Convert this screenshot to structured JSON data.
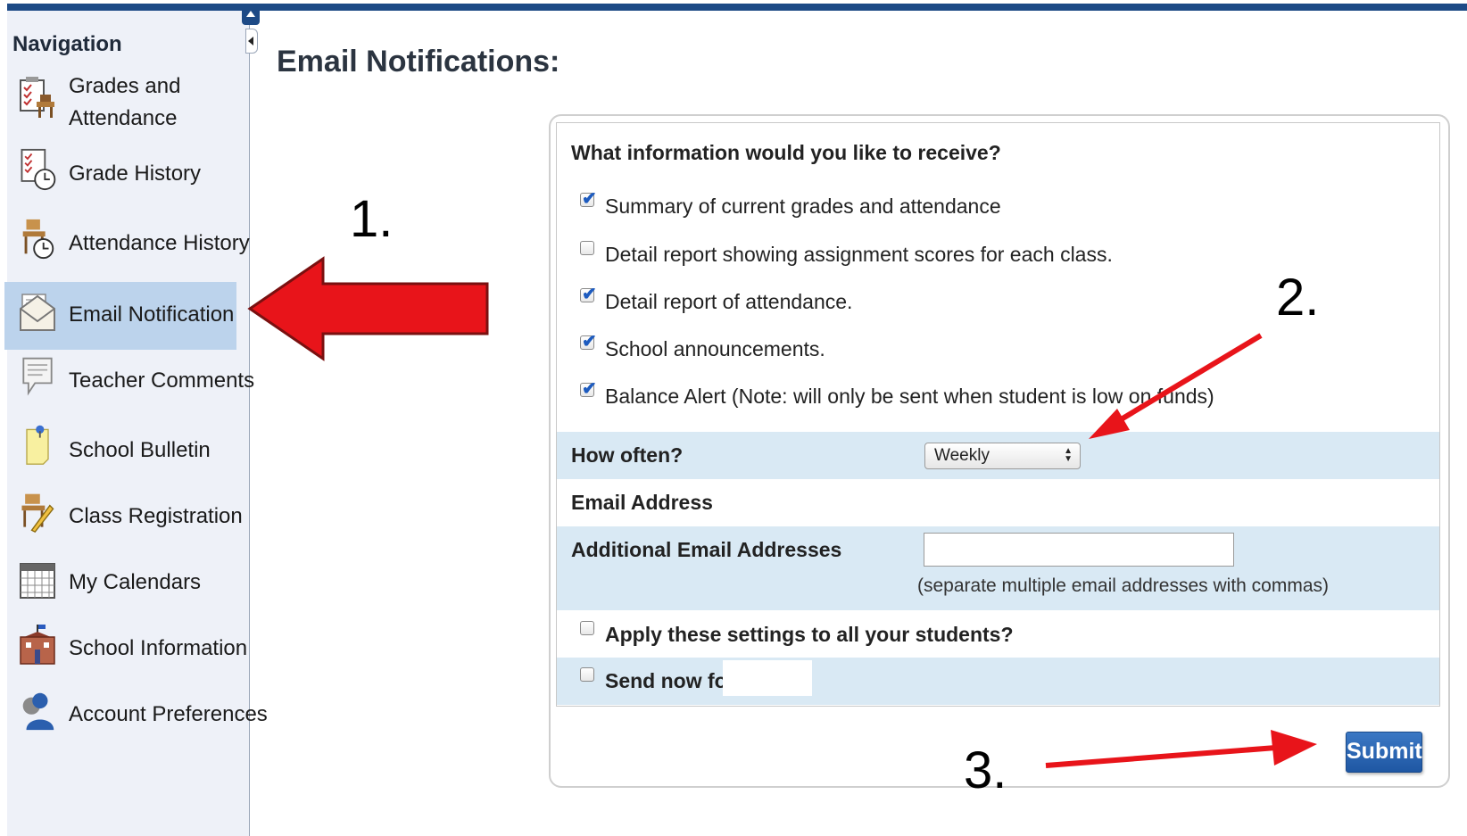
{
  "sidebar": {
    "title": "Navigation",
    "items": [
      {
        "label": "Grades and",
        "label2": "Attendance",
        "icon": "gradebook-attendance-icon"
      },
      {
        "label": "Grade History",
        "icon": "grade-history-icon"
      },
      {
        "label": "Attendance History",
        "icon": "attendance-history-icon"
      },
      {
        "label": "Email Notification",
        "icon": "envelope-icon",
        "active": true
      },
      {
        "label": "Teacher Comments",
        "icon": "speech-bubble-icon"
      },
      {
        "label": "School Bulletin",
        "icon": "bulletin-note-icon"
      },
      {
        "label": "Class Registration",
        "icon": "class-registration-icon"
      },
      {
        "label": "My Calendars",
        "icon": "calendar-icon"
      },
      {
        "label": "School Information",
        "icon": "school-building-icon"
      },
      {
        "label": "Account Preferences",
        "icon": "user-gear-icon"
      }
    ]
  },
  "page": {
    "title": "Email Notifications:"
  },
  "form": {
    "question": "What information would you like to receive?",
    "options": [
      {
        "label": "Summary of current grades and attendance",
        "checked": true
      },
      {
        "label": "Detail report showing assignment scores for each class.",
        "checked": false
      },
      {
        "label": "Detail report of attendance.",
        "checked": true
      },
      {
        "label": "School announcements.",
        "checked": true
      },
      {
        "label": "Balance Alert (Note: will only be sent when student is low on funds)",
        "checked": true
      }
    ],
    "how_often_label": "How often?",
    "how_often_value": "Weekly",
    "email_address_label": "Email Address",
    "additional_label": "Additional Email Addresses",
    "additional_value": "",
    "additional_hint": "(separate multiple email addresses with commas)",
    "apply_all_label": "Apply these settings to all your students?",
    "apply_all_checked": false,
    "send_now_label": "Send now for",
    "send_now_checked": false,
    "submit_label": "Submit"
  },
  "annotations": {
    "one": "1.",
    "two": "2.",
    "three": "3.",
    "arrow_color": "#e8141a"
  }
}
